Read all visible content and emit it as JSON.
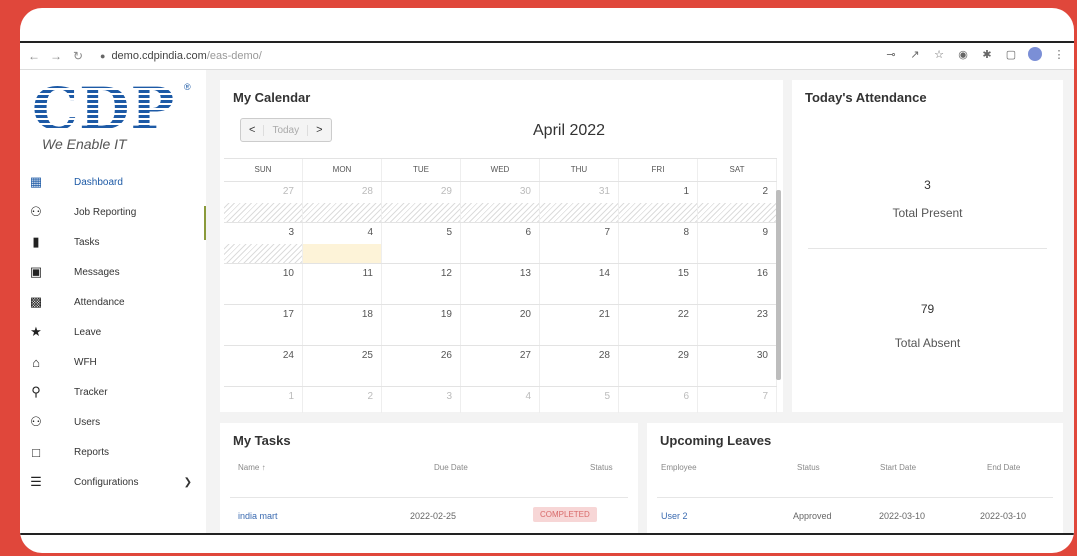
{
  "browser": {
    "url_host": "demo.cdpindia.com",
    "url_path": "/eas-demo/"
  },
  "brand": {
    "logo_text": "CDP",
    "registered_mark": "®",
    "tagline": "We Enable IT",
    "color": "#1d5aa6"
  },
  "sidebar": {
    "items": [
      {
        "label": "Dashboard",
        "icon": "dashboard-icon"
      },
      {
        "label": "Job Reporting",
        "icon": "team-icon"
      },
      {
        "label": "Tasks",
        "icon": "file-icon"
      },
      {
        "label": "Messages",
        "icon": "message-icon"
      },
      {
        "label": "Attendance",
        "icon": "contact-card-icon"
      },
      {
        "label": "Leave",
        "icon": "walking-icon"
      },
      {
        "label": "WFH",
        "icon": "home-icon"
      },
      {
        "label": "Tracker",
        "icon": "location-icon"
      },
      {
        "label": "Users",
        "icon": "users-icon"
      },
      {
        "label": "Reports",
        "icon": "reports-icon"
      },
      {
        "label": "Configurations",
        "icon": "settings-sliders-icon"
      }
    ]
  },
  "calendar": {
    "title": "My Calendar",
    "prev": "<",
    "today": "Today",
    "next": ">",
    "month": "April 2022",
    "weekdays": [
      "SUN",
      "MON",
      "TUE",
      "WED",
      "THU",
      "FRI",
      "SAT"
    ],
    "weeks": [
      [
        "27",
        "28",
        "29",
        "30",
        "31",
        "1",
        "2"
      ],
      [
        "3",
        "4",
        "5",
        "6",
        "7",
        "8",
        "9"
      ],
      [
        "10",
        "11",
        "12",
        "13",
        "14",
        "15",
        "16"
      ],
      [
        "17",
        "18",
        "19",
        "20",
        "21",
        "22",
        "23"
      ],
      [
        "24",
        "25",
        "26",
        "27",
        "28",
        "29",
        "30"
      ],
      [
        "1",
        "2",
        "3",
        "4",
        "5",
        "6",
        "7"
      ]
    ]
  },
  "attendance": {
    "title": "Today's Attendance",
    "present_value": "3",
    "present_label": "Total Present",
    "absent_value": "79",
    "absent_label": "Total Absent"
  },
  "tasks": {
    "title": "My Tasks",
    "col_name": "Name ↑",
    "col_due": "Due Date",
    "col_status": "Status",
    "row": {
      "name": "india mart",
      "due": "2022-02-25",
      "status": "COMPLETED"
    }
  },
  "leaves": {
    "title": "Upcoming Leaves",
    "col_employee": "Employee",
    "col_status": "Status",
    "col_start": "Start Date",
    "col_end": "End Date",
    "row": {
      "employee": "User 2",
      "status": "Approved",
      "start": "2022-03-10",
      "end": "2022-03-10"
    }
  }
}
